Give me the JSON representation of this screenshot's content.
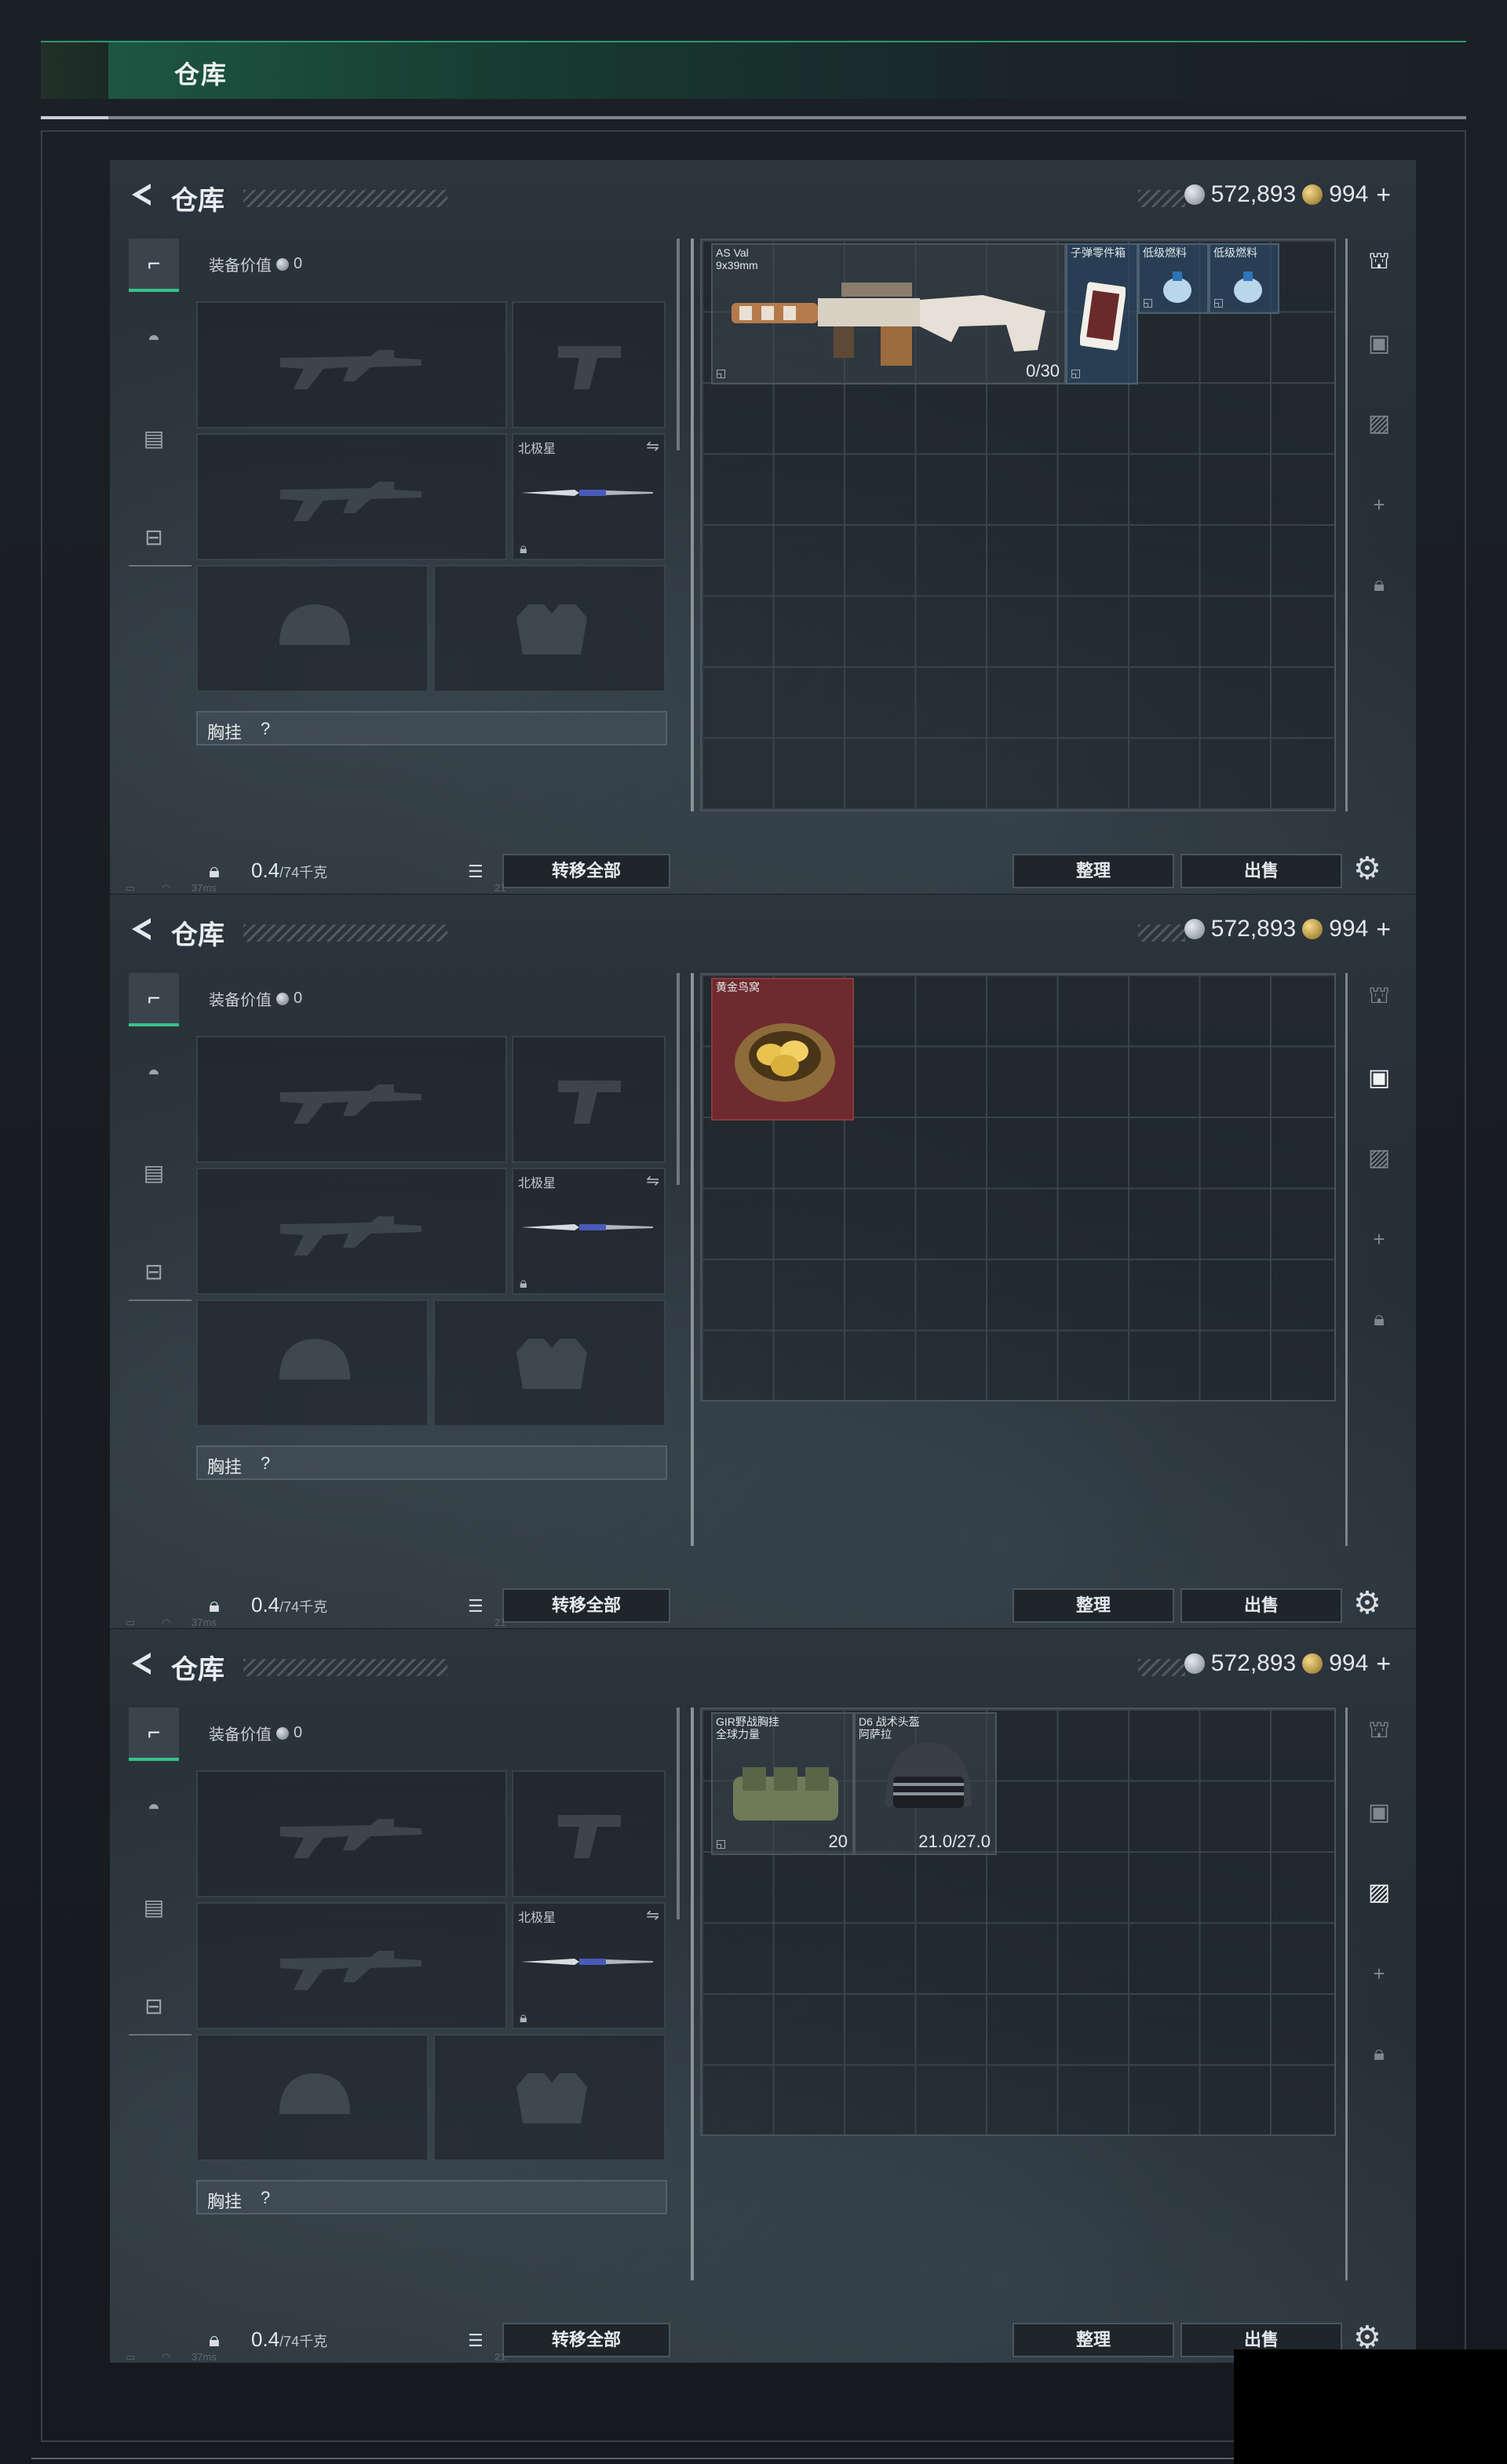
{
  "header": {
    "title": "仓库"
  },
  "panels": [
    {
      "title": "仓库",
      "silver": "572,893",
      "gold": "994",
      "gold_plus": "+",
      "equip_value_label": "装备价值",
      "equip_value": "0",
      "melee_label": "北极星",
      "chest_label": "胸挂",
      "chest_hint": "?",
      "weight": "0.4",
      "weight_max": "/74千克",
      "transfer_label": "转移全部",
      "sort_label": "整理",
      "sell_label": "出售",
      "status_ping": "37ms",
      "status_num": "21",
      "items": [
        {
          "name": "AS Val\n9x39mm",
          "count": "0/30"
        },
        {
          "name": "子弹零件箱"
        },
        {
          "name": "低级燃料"
        },
        {
          "name": "低级燃料"
        }
      ]
    },
    {
      "title": "仓库",
      "silver": "572,893",
      "gold": "994",
      "gold_plus": "+",
      "equip_value_label": "装备价值",
      "equip_value": "0",
      "melee_label": "北极星",
      "chest_label": "胸挂",
      "chest_hint": "?",
      "weight": "0.4",
      "weight_max": "/74千克",
      "transfer_label": "转移全部",
      "sort_label": "整理",
      "sell_label": "出售",
      "status_ping": "37ms",
      "status_num": "21",
      "items": [
        {
          "name": "黄金鸟窝"
        }
      ]
    },
    {
      "title": "仓库",
      "silver": "572,893",
      "gold": "994",
      "gold_plus": "+",
      "equip_value_label": "装备价值",
      "equip_value": "0",
      "melee_label": "北极星",
      "chest_label": "胸挂",
      "chest_hint": "?",
      "weight": "0.4",
      "weight_max": "/74千克",
      "transfer_label": "转移全部",
      "sort_label": "整理",
      "sell_label": "出售",
      "status_ping": "37ms",
      "status_num": "21",
      "items": [
        {
          "name": "GIR野战胸挂\n全球力量",
          "count": "20"
        },
        {
          "name": "D6 战术头盔\n阿萨拉",
          "count": "21.0/27.0"
        }
      ]
    }
  ],
  "colors": {
    "accent_green": "#39c18a",
    "item_red": "#6e2a2e"
  }
}
